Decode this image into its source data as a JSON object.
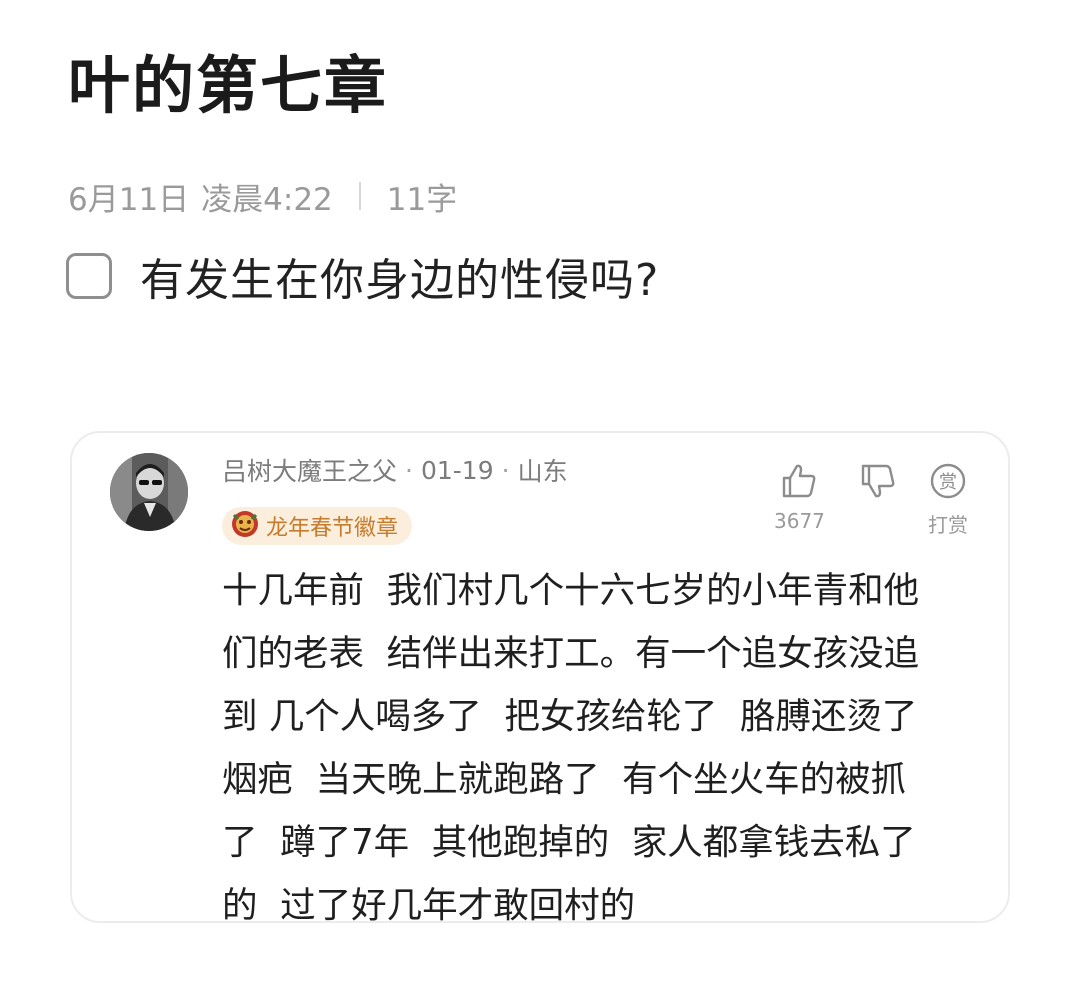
{
  "note": {
    "title": "叶的第七章",
    "date": "6月11日",
    "time": "凌晨4:22",
    "word_count": "11字",
    "todo_text": "有发生在你身边的性侵吗?"
  },
  "comment": {
    "author": "吕树大魔王之父",
    "dot": "·",
    "date": "01-19",
    "location": "山东",
    "badge": "龙年春节徽章",
    "like_count": "3677",
    "reward_label": "打赏",
    "reward_icon_char": "赏",
    "icons": {
      "like": "thumbs-up-icon",
      "dislike": "thumbs-down-icon",
      "reward": "reward-coin-icon",
      "badge": "dragon-badge-icon"
    },
    "lines": [
      "十几年前  我们村几个十六七岁的小年青和他",
      "们的老表  结伴出来打工。有一个追女孩没追",
      "到 几个人喝多了  把女孩给轮了  胳膊还烫了",
      "烟疤  当天晚上就跑路了  有个坐火车的被抓",
      "了  蹲了7年  其他跑掉的  家人都拿钱去私了",
      "的  过了好几年才敢回村的"
    ]
  },
  "colors": {
    "badge_bg": "#fbeedd",
    "badge_text": "#c67c2f",
    "meta_text": "#9a9a9a"
  }
}
